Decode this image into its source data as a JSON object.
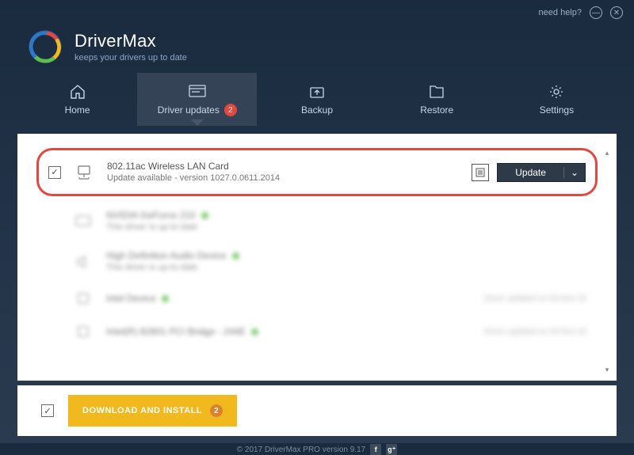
{
  "titlebar": {
    "help": "need help?"
  },
  "brand": {
    "name": "DriverMax",
    "tagline": "keeps your drivers up to date"
  },
  "tabs": {
    "home": "Home",
    "updates": "Driver updates",
    "updates_badge": "2",
    "backup": "Backup",
    "restore": "Restore",
    "settings": "Settings"
  },
  "highlight": {
    "title": "802.11ac Wireless LAN Card",
    "sub": "Update available - version 1027.0.0611.2014",
    "btn": "Update"
  },
  "rows": [
    {
      "title": "NVIDIA GeForce 210",
      "sub": "This driver is up-to-date"
    },
    {
      "title": "High Definition Audio Device",
      "sub": "This driver is up-to-date"
    },
    {
      "title": "Intel Device",
      "sub": "",
      "meta": "Driver updated on 03-Nov-16"
    },
    {
      "title": "Intel(R) 82801 PCI Bridge - 244E",
      "sub": "",
      "meta": "Driver updated on 03-Nov-16"
    }
  ],
  "bottom": {
    "download": "DOWNLOAD AND INSTALL",
    "badge": "2"
  },
  "footer": {
    "copy": "© 2017 DriverMax PRO version 9.17"
  }
}
